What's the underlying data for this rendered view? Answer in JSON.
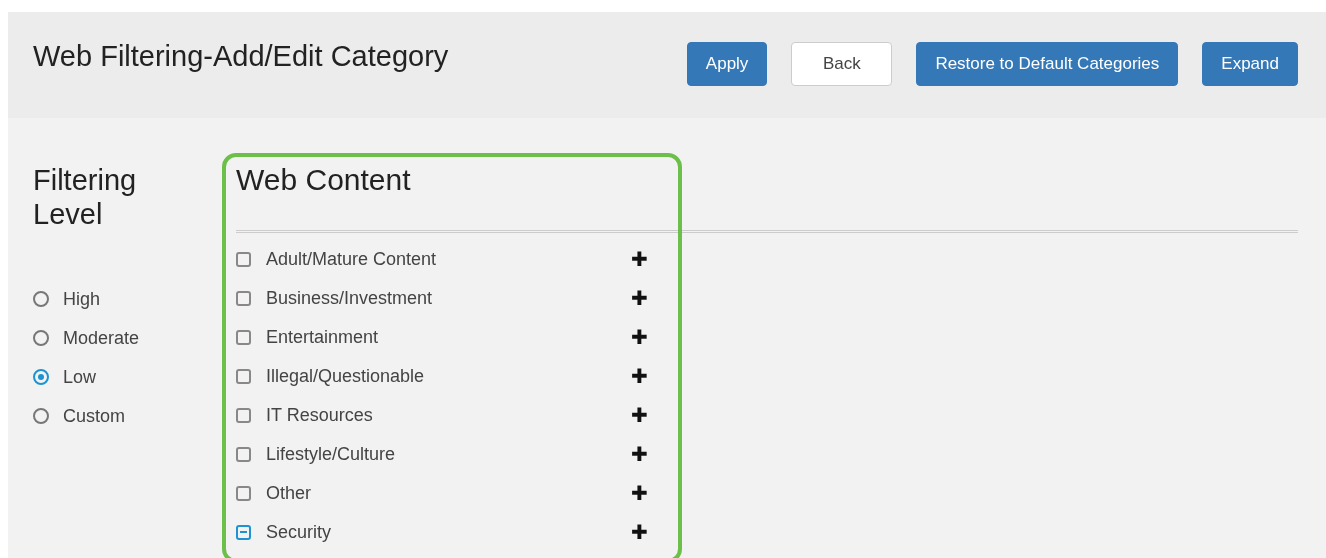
{
  "header": {
    "title": "Web Filtering-Add/Edit Category",
    "buttons": [
      {
        "label": "Apply",
        "kind": "primary"
      },
      {
        "label": "Back",
        "kind": "secondary"
      },
      {
        "label": "Restore to Default Categories",
        "kind": "primary"
      },
      {
        "label": "Expand",
        "kind": "primary"
      }
    ]
  },
  "filtering_level": {
    "title": "Filtering Level",
    "options": [
      {
        "label": "High",
        "selected": false
      },
      {
        "label": "Moderate",
        "selected": false
      },
      {
        "label": "Low",
        "selected": true
      },
      {
        "label": "Custom",
        "selected": false
      }
    ]
  },
  "web_content": {
    "title": "Web Content",
    "highlighted": true,
    "categories": [
      {
        "label": "Adult/Mature Content",
        "indeterminate": false,
        "expand": "✚"
      },
      {
        "label": "Business/Investment",
        "indeterminate": false,
        "expand": "✚"
      },
      {
        "label": "Entertainment",
        "indeterminate": false,
        "expand": "✚"
      },
      {
        "label": "Illegal/Questionable",
        "indeterminate": false,
        "expand": "✚"
      },
      {
        "label": "IT Resources",
        "indeterminate": false,
        "expand": "✚"
      },
      {
        "label": "Lifestyle/Culture",
        "indeterminate": false,
        "expand": "✚"
      },
      {
        "label": "Other",
        "indeterminate": false,
        "expand": "✚"
      },
      {
        "label": "Security",
        "indeterminate": true,
        "expand": "✚"
      }
    ]
  }
}
